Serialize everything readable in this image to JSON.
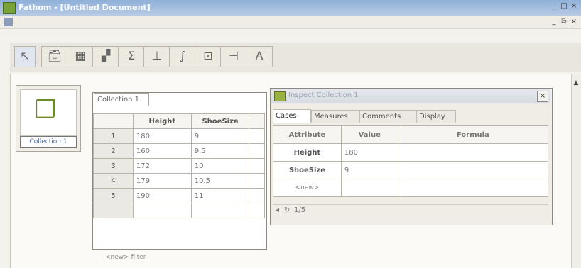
{
  "window": {
    "title": "Fathom - [Untitled Document]"
  },
  "menu": [],
  "window_controls": [
    "_",
    "□",
    "×"
  ],
  "doc_controls": [
    "_",
    "⧉",
    "×"
  ],
  "toolbar": {
    "tools": [
      {
        "name": "pointer-tool",
        "glyph": "↖"
      },
      {
        "name": "collection-tool",
        "glyph": "🗃"
      },
      {
        "name": "table-tool",
        "glyph": "▦"
      },
      {
        "name": "graph-tool",
        "glyph": "▞"
      },
      {
        "name": "summary-tool",
        "glyph": "Σ"
      },
      {
        "name": "estimate-tool",
        "glyph": "⊥"
      },
      {
        "name": "test-tool",
        "glyph": "∫"
      },
      {
        "name": "model-tool",
        "glyph": "⊡"
      },
      {
        "name": "slider-tool",
        "glyph": "⊣"
      },
      {
        "name": "text-tool",
        "glyph": "A"
      }
    ]
  },
  "collection_icon": {
    "label": "Collection 1"
  },
  "case_table": {
    "tab_label": "Collection 1",
    "columns": [
      "Height",
      "ShoeSize"
    ],
    "rows": [
      {
        "index": "1",
        "height": "180",
        "shoesize": "9"
      },
      {
        "index": "2",
        "height": "160",
        "shoesize": "9.5"
      },
      {
        "index": "3",
        "height": "172",
        "shoesize": "10"
      },
      {
        "index": "4",
        "height": "179",
        "shoesize": "10.5"
      },
      {
        "index": "5",
        "height": "190",
        "shoesize": "11"
      }
    ],
    "footer": "<new> filter"
  },
  "inspector": {
    "title": "Inspect Collection 1",
    "tabs": [
      "Cases",
      "Measures",
      "Comments",
      "Display"
    ],
    "active_tab": "Cases",
    "columns": [
      "Attribute",
      "Value",
      "Formula"
    ],
    "rows": [
      {
        "attribute": "Height",
        "value": "180",
        "formula": ""
      },
      {
        "attribute": "ShoeSize",
        "value": "9",
        "formula": ""
      },
      {
        "attribute": "<new>",
        "value": "",
        "formula": ""
      }
    ],
    "case_counter": "1/5"
  },
  "colors": {
    "title_bar": "#8fb0d8",
    "workspace": "#fbfaf7",
    "app_icon": "#7aa23a"
  }
}
